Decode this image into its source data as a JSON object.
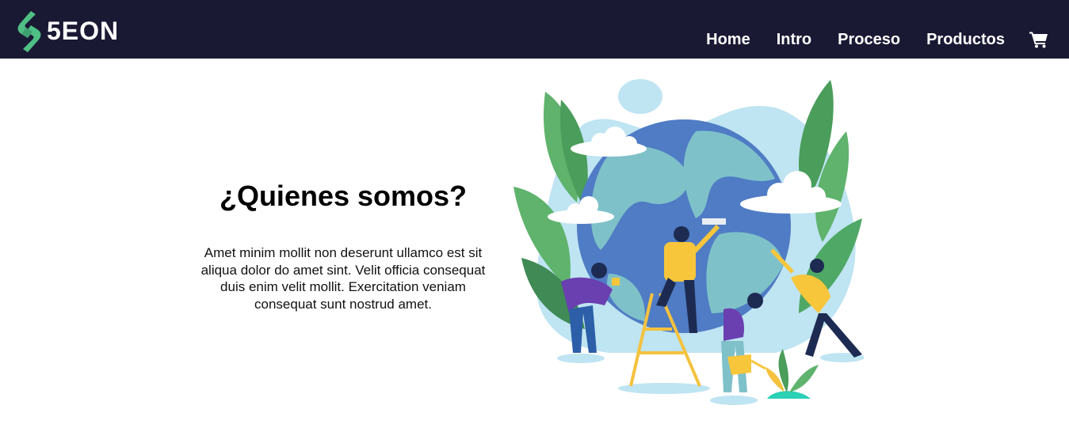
{
  "header": {
    "brand": "5EON",
    "nav": [
      {
        "label": "Home"
      },
      {
        "label": "Intro"
      },
      {
        "label": "Proceso"
      },
      {
        "label": "Productos"
      }
    ],
    "cart_icon": "shopping-cart-icon",
    "background": "#1a1934",
    "logo_accent": "#4fbf85"
  },
  "about": {
    "title": "¿Quienes somos?",
    "body": "Amet minim mollit non deserunt ullamco est sit aliqua dolor do amet sint. Velit officia consequat duis enim velit mollit. Exercitation veniam consequat sunt nostrud amet."
  },
  "illustration": {
    "subject": "people-painting-planet-earth-illustration"
  }
}
